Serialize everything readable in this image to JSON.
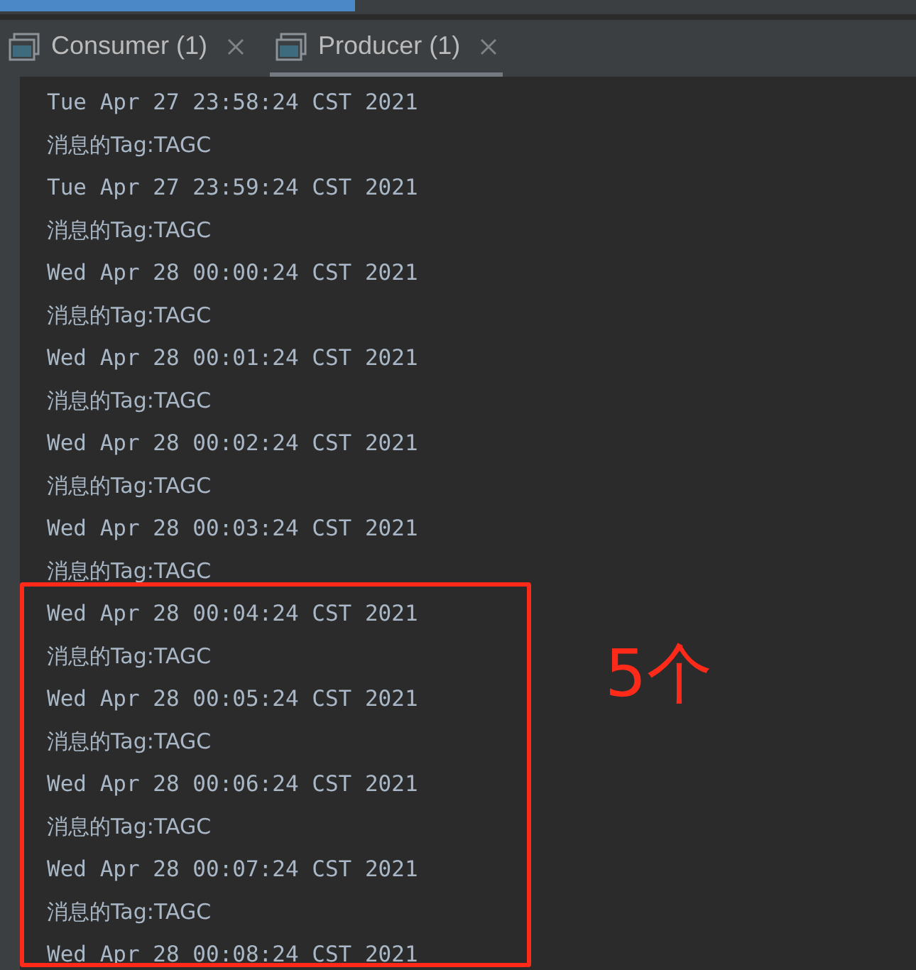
{
  "tabs": [
    {
      "label": "Consumer (1)",
      "selected": false
    },
    {
      "label": "Producer (1)",
      "selected": true
    }
  ],
  "console_lines": [
    {
      "kind": "date",
      "text": "Tue Apr 27 23:58:24 CST 2021"
    },
    {
      "kind": "message",
      "text": "消息的Tag:TAGC"
    },
    {
      "kind": "date",
      "text": "Tue Apr 27 23:59:24 CST 2021"
    },
    {
      "kind": "message",
      "text": "消息的Tag:TAGC"
    },
    {
      "kind": "date",
      "text": "Wed Apr 28 00:00:24 CST 2021"
    },
    {
      "kind": "message",
      "text": "消息的Tag:TAGC"
    },
    {
      "kind": "date",
      "text": "Wed Apr 28 00:01:24 CST 2021"
    },
    {
      "kind": "message",
      "text": "消息的Tag:TAGC"
    },
    {
      "kind": "date",
      "text": "Wed Apr 28 00:02:24 CST 2021"
    },
    {
      "kind": "message",
      "text": "消息的Tag:TAGC"
    },
    {
      "kind": "date",
      "text": "Wed Apr 28 00:03:24 CST 2021"
    },
    {
      "kind": "message",
      "text": "消息的Tag:TAGC"
    },
    {
      "kind": "date",
      "text": "Wed Apr 28 00:04:24 CST 2021"
    },
    {
      "kind": "message",
      "text": "消息的Tag:TAGC"
    },
    {
      "kind": "date",
      "text": "Wed Apr 28 00:05:24 CST 2021"
    },
    {
      "kind": "message",
      "text": "消息的Tag:TAGC"
    },
    {
      "kind": "date",
      "text": "Wed Apr 28 00:06:24 CST 2021"
    },
    {
      "kind": "message",
      "text": "消息的Tag:TAGC"
    },
    {
      "kind": "date",
      "text": "Wed Apr 28 00:07:24 CST 2021"
    },
    {
      "kind": "message",
      "text": "消息的Tag:TAGC"
    },
    {
      "kind": "date",
      "text": "Wed Apr 28 00:08:24 CST 2021"
    }
  ],
  "annotation": {
    "label": "5个"
  }
}
